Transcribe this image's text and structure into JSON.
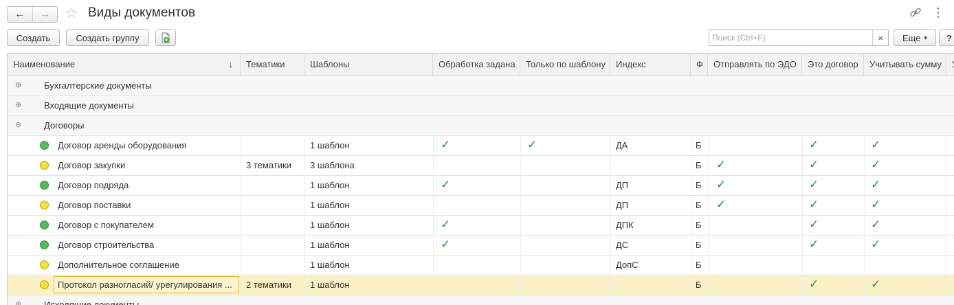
{
  "window": {
    "title": "Виды документов",
    "back_icon": "←",
    "forward_icon": "→",
    "star_icon": "☆",
    "more_icon": "⋮"
  },
  "toolbar": {
    "create_label": "Создать",
    "create_group_label": "Создать группу",
    "search_placeholder": "Поиск (Ctrl+F)",
    "clear_icon": "×",
    "more_label": "Еще",
    "more_caret": "▾",
    "help_label": "?"
  },
  "table": {
    "columns": {
      "name": "Наименование",
      "sort_arrow": "↓",
      "topics": "Тематики",
      "templates": "Шаблоны",
      "processing": "Обработка задана",
      "only_template": "Только по шаблону",
      "index": "Индекс",
      "f": "Ф",
      "send_edo": "Отправлять по ЭДО",
      "is_contract": "Это договор",
      "account_sum": "Учитывать сумму",
      "last": "У"
    },
    "groups": {
      "accounting": "Бухгалтерские документы",
      "incoming": "Входящие документы",
      "contracts": "Договоры",
      "outgoing": "Исходящие документы"
    },
    "expand_icon": "⊕",
    "collapse_icon": "⊖",
    "check_icon": "✓",
    "rows": [
      {
        "name": "Договор аренды оборудования",
        "status": "green",
        "topics": "",
        "templates": "1 шаблон",
        "processing": true,
        "only_template": true,
        "index": "ДА",
        "f": "Б",
        "send_edo": false,
        "is_contract": true,
        "account_sum": true
      },
      {
        "name": "Договор закупки",
        "status": "yellow",
        "topics": "3 тематики",
        "templates": "3 шаблона",
        "processing": false,
        "only_template": false,
        "index": "",
        "f": "Б",
        "send_edo": true,
        "is_contract": true,
        "account_sum": true
      },
      {
        "name": "Договор подряда",
        "status": "green",
        "topics": "",
        "templates": "1 шаблон",
        "processing": true,
        "only_template": false,
        "index": "ДП",
        "f": "Б",
        "send_edo": true,
        "is_contract": true,
        "account_sum": true
      },
      {
        "name": "Договор поставки",
        "status": "yellow",
        "topics": "",
        "templates": "1 шаблон",
        "processing": false,
        "only_template": false,
        "index": "ДП",
        "f": "Б",
        "send_edo": true,
        "is_contract": true,
        "account_sum": true
      },
      {
        "name": "Договор с покупателем",
        "status": "green",
        "topics": "",
        "templates": "1 шаблон",
        "processing": true,
        "only_template": false,
        "index": "ДПК",
        "f": "Б",
        "send_edo": false,
        "is_contract": true,
        "account_sum": true
      },
      {
        "name": "Договор строительства",
        "status": "green",
        "topics": "",
        "templates": "1 шаблон",
        "processing": true,
        "only_template": false,
        "index": "ДС",
        "f": "Б",
        "send_edo": false,
        "is_contract": true,
        "account_sum": true
      },
      {
        "name": "Дополнительное соглашение",
        "status": "yellow",
        "topics": "",
        "templates": "1 шаблон",
        "processing": false,
        "only_template": false,
        "index": "ДопС",
        "f": "Б",
        "send_edo": false,
        "is_contract": false,
        "account_sum": false
      },
      {
        "name": "Протокол разногласий/ урегулирования ...",
        "status": "yellow",
        "topics": "2 тематики",
        "templates": "1 шаблон",
        "processing": false,
        "only_template": false,
        "index": "",
        "f": "Б",
        "send_edo": false,
        "is_contract": true,
        "account_sum": true
      }
    ]
  }
}
